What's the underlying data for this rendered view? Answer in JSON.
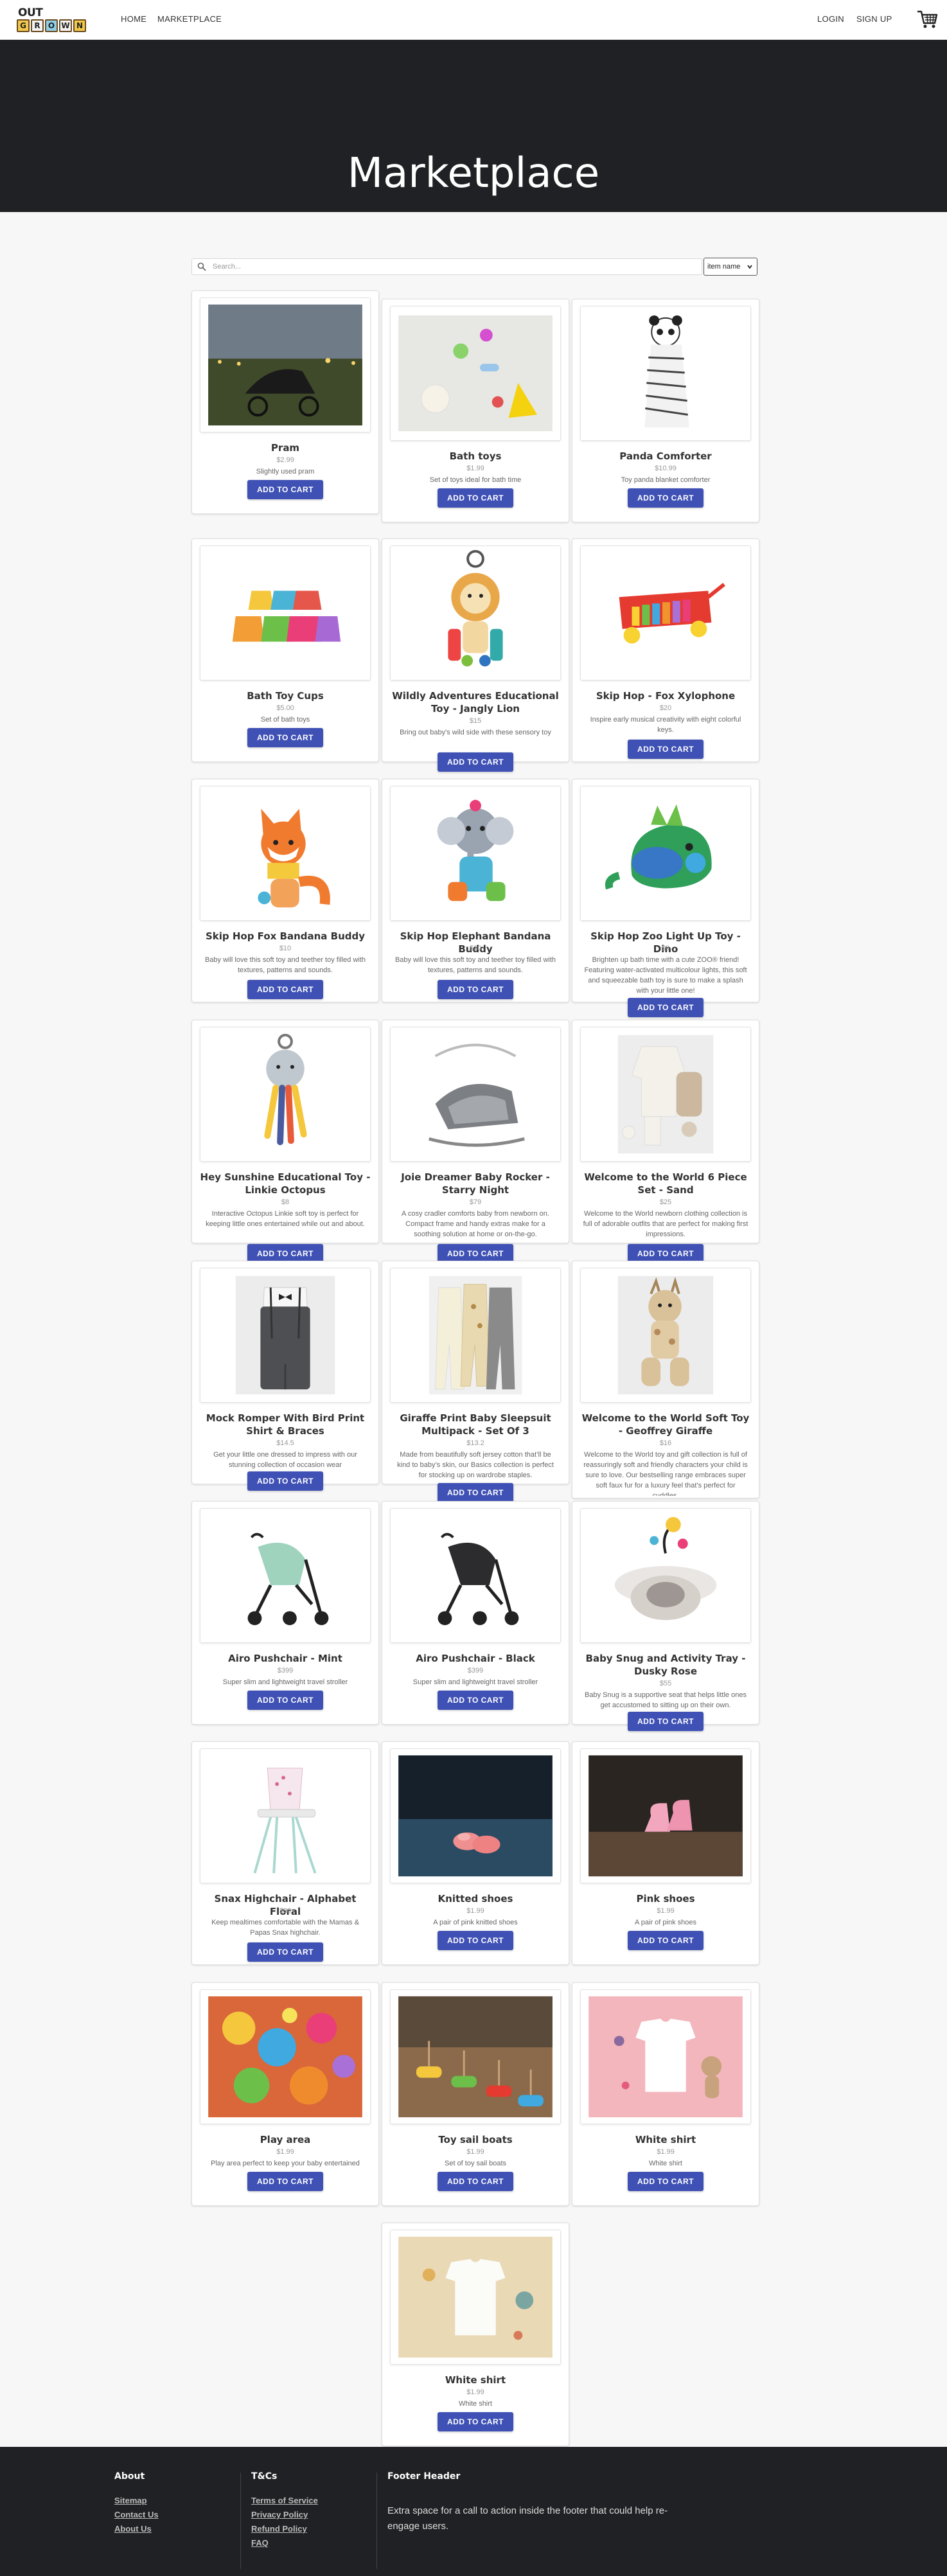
{
  "nav": {
    "logo_top": "OUT",
    "logo_blocks": [
      "G",
      "R",
      "O",
      "W",
      "N"
    ],
    "links": [
      "HOME",
      "MARKETPLACE"
    ],
    "login": "LOGIN",
    "signup": "SIGN UP"
  },
  "hero": {
    "title": "Marketplace"
  },
  "search": {
    "placeholder": "Search...",
    "sort_value": "item name"
  },
  "button_label": "ADD TO CART",
  "products": [
    {
      "title": "Pram",
      "price": "$2.99",
      "desc": "Slightly used pram"
    },
    {
      "title": "Bath toys",
      "price": "$1.99",
      "desc": "Set of toys ideal for bath time"
    },
    {
      "title": "Panda Comforter",
      "price": "$10.99",
      "desc": "Toy panda blanket comforter"
    },
    {
      "title": "Bath Toy Cups",
      "price": "$5.00",
      "desc": "Set of bath toys"
    },
    {
      "title": "Wildly Adventures Educational Toy - Jangly Lion",
      "price": "$15",
      "desc": "Bring out baby's wild side with these sensory toy"
    },
    {
      "title": "Skip Hop - Fox Xylophone",
      "price": "$20",
      "desc": "Inspire early musical creativity with eight colorful keys."
    },
    {
      "title": "Skip Hop Fox Bandana Buddy",
      "price": "$10",
      "desc": "Baby will love this soft toy and teether toy filled with textures, patterns and sounds."
    },
    {
      "title": "Skip Hop Elephant Bandana Buddy",
      "price": "$10",
      "desc": "Baby will love this soft toy and teether toy filled with textures, patterns and sounds."
    },
    {
      "title": "Skip Hop Zoo Light Up Toy - Dino",
      "price": "$9",
      "desc": "Brighten up bath time with a cute ZOO® friend! Featuring water-activated multicolour lights, this soft and squeezable bath toy is sure to make a splash with your little one!"
    },
    {
      "title": "Hey Sunshine Educational Toy - Linkie Octopus",
      "price": "$8",
      "desc": "Interactive Octopus Linkie soft toy is perfect for keeping little ones entertained while out and about."
    },
    {
      "title": "Joie Dreamer Baby Rocker - Starry Night",
      "price": "$79",
      "desc": "A cosy cradler comforts baby from newborn on. Compact frame and handy extras make for a soothing solution at home or on-the-go."
    },
    {
      "title": "Welcome to the World 6 Piece Set - Sand",
      "price": "$25",
      "desc": "Welcome to the World newborn clothing collection is full of adorable outfits that are perfect for making first impressions."
    },
    {
      "title": "Mock Romper With Bird Print Shirt & Braces",
      "price": "$14.5",
      "desc": "Get your little one dressed to impress with our stunning collection of occasion wear"
    },
    {
      "title": "Giraffe Print Baby Sleepsuit Multipack - Set Of 3",
      "price": "$13.2",
      "desc": "Made from beautifully soft jersey cotton that’ll be kind to baby’s skin, our Basics collection is perfect for stocking up on wardrobe staples."
    },
    {
      "title": "Welcome to the World Soft Toy - Geoffrey Giraffe",
      "price": "$16",
      "desc": "Welcome to the World toy and gift collection is full of reassuringly soft and friendly characters your child is sure to love. Our bestselling range embraces super soft faux fur for a luxury feel that's perfect for cuddles."
    },
    {
      "title": "Airo Pushchair - Mint",
      "price": "$399",
      "desc": "Super slim and lightweight travel stroller"
    },
    {
      "title": "Airo Pushchair - Black",
      "price": "$399",
      "desc": "Super slim and lightweight travel stroller"
    },
    {
      "title": "Baby Snug and Activity Tray - Dusky Rose",
      "price": "$55",
      "desc": "Baby Snug is a supportive seat that helps little ones get accustomed to sitting up on their own."
    },
    {
      "title": "Snax Highchair - Alphabet Floral",
      "price": "$80",
      "desc": "Keep mealtimes comfortable with the Mamas & Papas Snax highchair."
    },
    {
      "title": "Knitted shoes",
      "price": "$1.99",
      "desc": "A pair of pink knitted shoes"
    },
    {
      "title": "Pink shoes",
      "price": "$1.99",
      "desc": "A pair of pink shoes"
    },
    {
      "title": "Play area",
      "price": "$1.99",
      "desc": "Play area perfect to keep your baby entertained"
    },
    {
      "title": "Toy sail boats",
      "price": "$1.99",
      "desc": "Set of toy sail boats"
    },
    {
      "title": "White shirt",
      "price": "$1.99",
      "desc": "White shirt"
    },
    {
      "title": "White shirt",
      "price": "$1.99",
      "desc": "White shirt"
    }
  ],
  "footer": {
    "about_heading": "About",
    "about_links": [
      "Sitemap",
      "Contact Us",
      "About Us"
    ],
    "tcs_heading": "T&Cs",
    "tcs_links": [
      "Terms of Service",
      "Privacy Policy",
      "Refund Policy",
      "FAQ"
    ],
    "header_heading": "Footer Header",
    "header_text": "Extra space for a call to action inside the footer that could help re-engage users."
  }
}
